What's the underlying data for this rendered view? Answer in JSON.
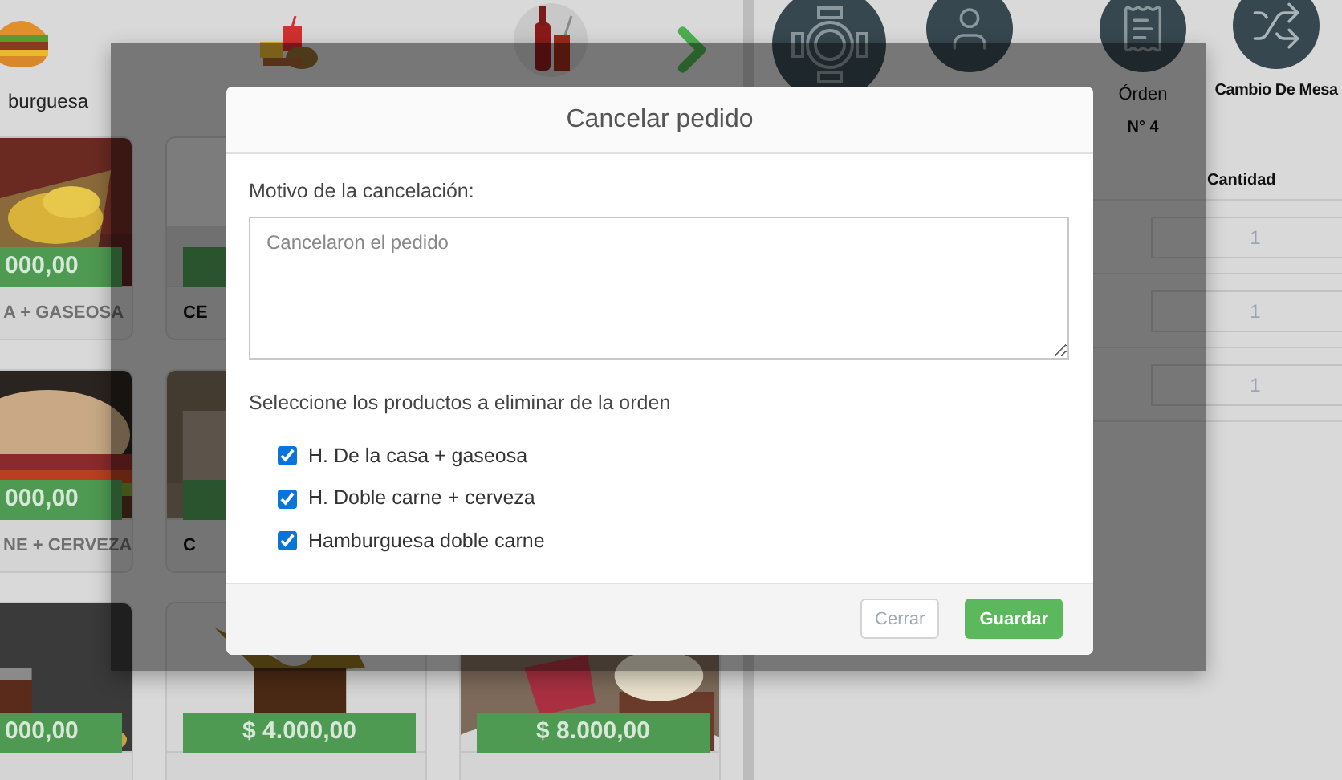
{
  "categories": [
    {
      "label": "burguesa",
      "kind": "burger"
    },
    {
      "kind": "combo"
    },
    {
      "kind": "drink"
    }
  ],
  "product_rows": [
    [
      {
        "price": "000,00",
        "name": "A + GASEOSA",
        "kind": "fries"
      },
      {
        "name": "CE",
        "kind": "plain"
      }
    ],
    [
      {
        "price": "000,00",
        "name": "NE + CERVEZA",
        "kind": "burger"
      },
      {
        "name": "C",
        "kind": "beer"
      }
    ],
    [
      {
        "price": "000,00",
        "kind": "soda"
      },
      {
        "price": "$ 4.000,00",
        "kind": "splash"
      },
      {
        "price": "$ 8.000,00",
        "kind": "dessert"
      }
    ]
  ],
  "actions": [
    {
      "kind": "table"
    },
    {
      "kind": "person"
    },
    {
      "kind": "receipt",
      "label": "Órden",
      "sublabel": "N° 4"
    },
    {
      "kind": "shuffle",
      "label": "Cambio De Mesa"
    }
  ],
  "order_table": {
    "columns": [
      "Cantidad"
    ],
    "rows": [
      {
        "quantity": "1"
      },
      {
        "quantity": "1"
      },
      {
        "quantity": "1"
      }
    ]
  },
  "modal": {
    "title": "Cancelar pedido",
    "reason_label": "Motivo de la cancelación:",
    "reason": {
      "placeholder": "Cancelaron el pedido"
    },
    "products_label": "Seleccione los productos a eliminar de la orden",
    "products_to_remove": [
      {
        "label": "H. De la casa + gaseosa",
        "checked": true
      },
      {
        "label": "H. Doble carne + cerveza",
        "checked": true
      },
      {
        "label": "Hamburguesa doble carne",
        "checked": true
      }
    ],
    "buttons": [
      {
        "label": "Cerrar",
        "kind": "secondary"
      },
      {
        "label": "Guardar",
        "kind": "primary"
      }
    ]
  }
}
